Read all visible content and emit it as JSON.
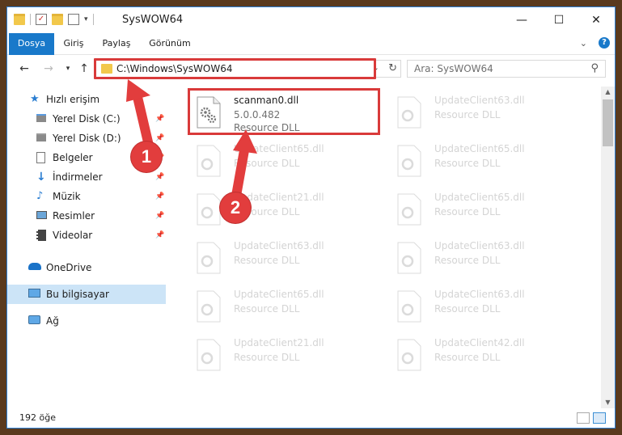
{
  "window": {
    "title": "SysWOW64"
  },
  "ribbon": {
    "tabs": [
      {
        "label": "Dosya"
      },
      {
        "label": "Giriş"
      },
      {
        "label": "Paylaş"
      },
      {
        "label": "Görünüm"
      }
    ]
  },
  "address": {
    "path": "C:\\Windows\\SysWOW64"
  },
  "search": {
    "placeholder": "Ara: SysWOW64"
  },
  "sidebar": {
    "items": [
      {
        "label": "Hızlı erişim",
        "icon": "star-icon"
      },
      {
        "label": "Yerel Disk (C:)",
        "icon": "drive-icon"
      },
      {
        "label": "Yerel Disk (D:)",
        "icon": "drive-icon"
      },
      {
        "label": "Belgeler",
        "icon": "document-icon"
      },
      {
        "label": "İndirmeler",
        "icon": "download-icon"
      },
      {
        "label": "Müzik",
        "icon": "music-icon"
      },
      {
        "label": "Resimler",
        "icon": "pictures-icon"
      },
      {
        "label": "Videolar",
        "icon": "video-icon"
      },
      {
        "label": "OneDrive",
        "icon": "cloud-icon"
      },
      {
        "label": "Bu bilgisayar",
        "icon": "computer-icon"
      },
      {
        "label": "Ağ",
        "icon": "network-icon"
      }
    ]
  },
  "files": [
    {
      "name": "scanman0.dll",
      "version": "5.0.0.482",
      "type": "Resource DLL"
    },
    {
      "name": "UpdateClient63.dll",
      "type": "Resource DLL"
    },
    {
      "name": "UpdateClient65.dll",
      "type": "Resource DLL"
    },
    {
      "name": "UpdateClient65.dll",
      "type": "Resource DLL"
    },
    {
      "name": "UpdateClient21.dll",
      "type": "Resource DLL"
    },
    {
      "name": "UpdateClient65.dll",
      "type": "Resource DLL"
    },
    {
      "name": "UpdateClient63.dll",
      "type": "Resource DLL"
    },
    {
      "name": "UpdateClient63.dll",
      "type": "Resource DLL"
    },
    {
      "name": "UpdateClient65.dll",
      "type": "Resource DLL"
    },
    {
      "name": "UpdateClient63.dll",
      "type": "Resource DLL"
    },
    {
      "name": "UpdateClient21.dll",
      "type": "Resource DLL"
    },
    {
      "name": "UpdateClient42.dll",
      "type": "Resource DLL"
    }
  ],
  "status": {
    "count": "192 öğe"
  },
  "annotations": {
    "step1": "1",
    "step2": "2",
    "color": "#e23d3d"
  }
}
